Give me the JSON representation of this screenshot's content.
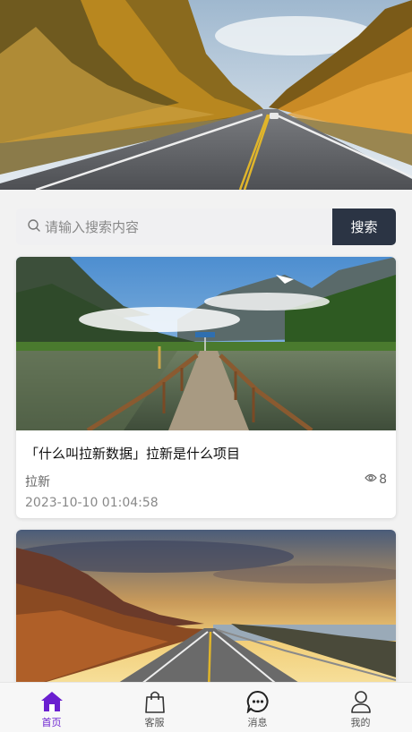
{
  "search": {
    "placeholder": "请输入搜索内容",
    "button_label": "搜索"
  },
  "articles": [
    {
      "title": "「什么叫拉新数据」拉新是什么项目",
      "tag": "拉新",
      "views": "8",
      "date": "2023-10-10 01:04:58",
      "image": "lake-pier-landscape"
    },
    {
      "title": "",
      "image": "sunset-road-landscape"
    }
  ],
  "tabbar": {
    "items": [
      {
        "label": "首页",
        "icon": "home-icon",
        "active": true
      },
      {
        "label": "客服",
        "icon": "shopping-bag-icon",
        "active": false
      },
      {
        "label": "消息",
        "icon": "message-icon",
        "active": false
      },
      {
        "label": "我的",
        "icon": "user-icon",
        "active": false
      }
    ]
  },
  "colors": {
    "accent": "#6a1fd0",
    "search_button": "#2b3444"
  }
}
